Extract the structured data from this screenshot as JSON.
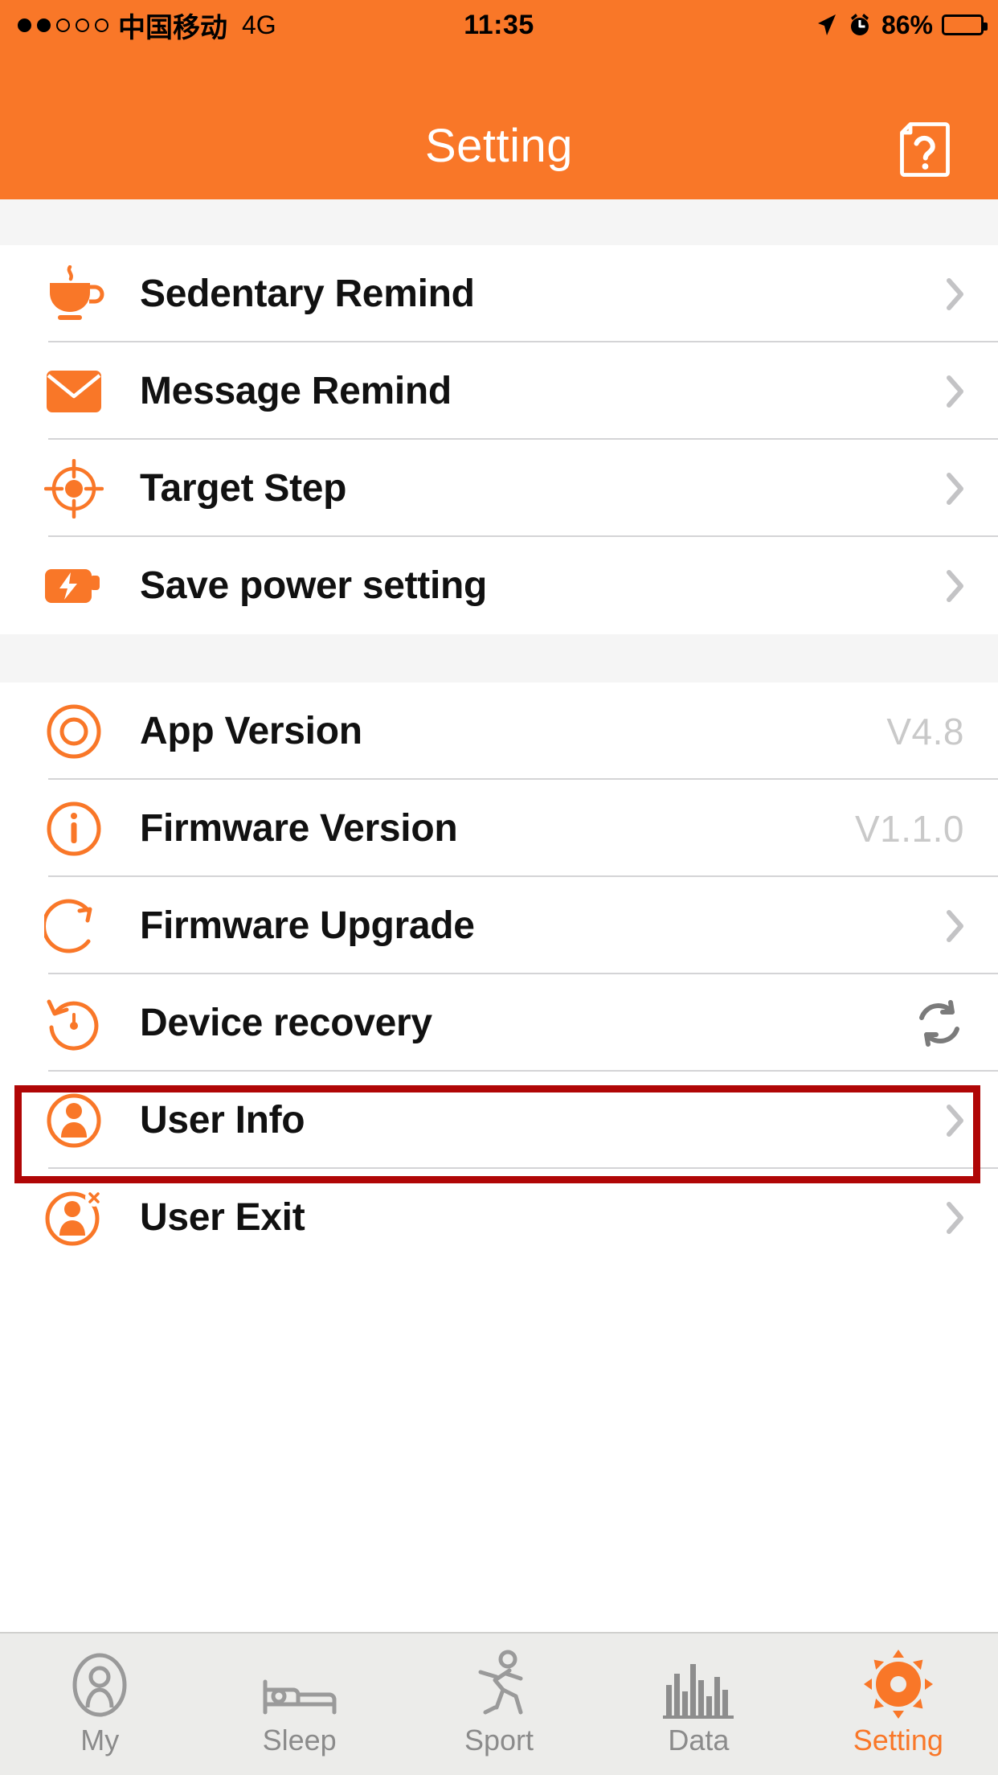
{
  "status_bar": {
    "signal_dots_filled": 2,
    "signal_dots_total": 5,
    "carrier": "中国移动",
    "network": "4G",
    "time": "11:35",
    "location_icon": "location-arrow-icon",
    "alarm_icon": "alarm-clock-icon",
    "battery_percent": "86%",
    "battery_level": 86
  },
  "nav": {
    "title": "Setting",
    "help_icon": "help-document-icon"
  },
  "colors": {
    "accent_orange": "#F97728",
    "highlight_red": "#B00606",
    "value_gray": "#C9C9C9",
    "tabbar_bg": "#ECECEA"
  },
  "annotation": {
    "target_row": "Firmware Upgrade",
    "border_color": "#B00606"
  },
  "list": {
    "group1": [
      {
        "icon": "coffee-cup-icon",
        "label": "Sedentary Remind",
        "accessory": "chevron"
      },
      {
        "icon": "envelope-icon",
        "label": "Message Remind",
        "accessory": "chevron"
      },
      {
        "icon": "target-crosshair-icon",
        "label": "Target Step",
        "accessory": "chevron"
      },
      {
        "icon": "battery-bolt-icon",
        "label": "Save power setting",
        "accessory": "chevron"
      }
    ],
    "group2": [
      {
        "icon": "concentric-circles-icon",
        "label": "App Version",
        "value": "V4.8",
        "accessory": "value"
      },
      {
        "icon": "info-circle-icon",
        "label": "Firmware Version",
        "value": "V1.1.0",
        "accessory": "value"
      },
      {
        "icon": "circular-arrow-icon",
        "label": "Firmware Upgrade",
        "accessory": "chevron"
      },
      {
        "icon": "restore-clock-icon",
        "label": "Device recovery",
        "accessory": "refresh"
      },
      {
        "icon": "user-circle-icon",
        "label": "User Info",
        "accessory": "chevron"
      },
      {
        "icon": "user-exit-icon",
        "label": "User Exit",
        "accessory": "chevron"
      }
    ]
  },
  "tabbar": {
    "items": [
      {
        "icon": "person-head-icon",
        "label": "My",
        "active": false
      },
      {
        "icon": "bed-icon",
        "label": "Sleep",
        "active": false
      },
      {
        "icon": "running-person-icon",
        "label": "Sport",
        "active": false
      },
      {
        "icon": "bar-chart-icon",
        "label": "Data",
        "active": false
      },
      {
        "icon": "gear-icon",
        "label": "Setting",
        "active": true
      }
    ]
  }
}
